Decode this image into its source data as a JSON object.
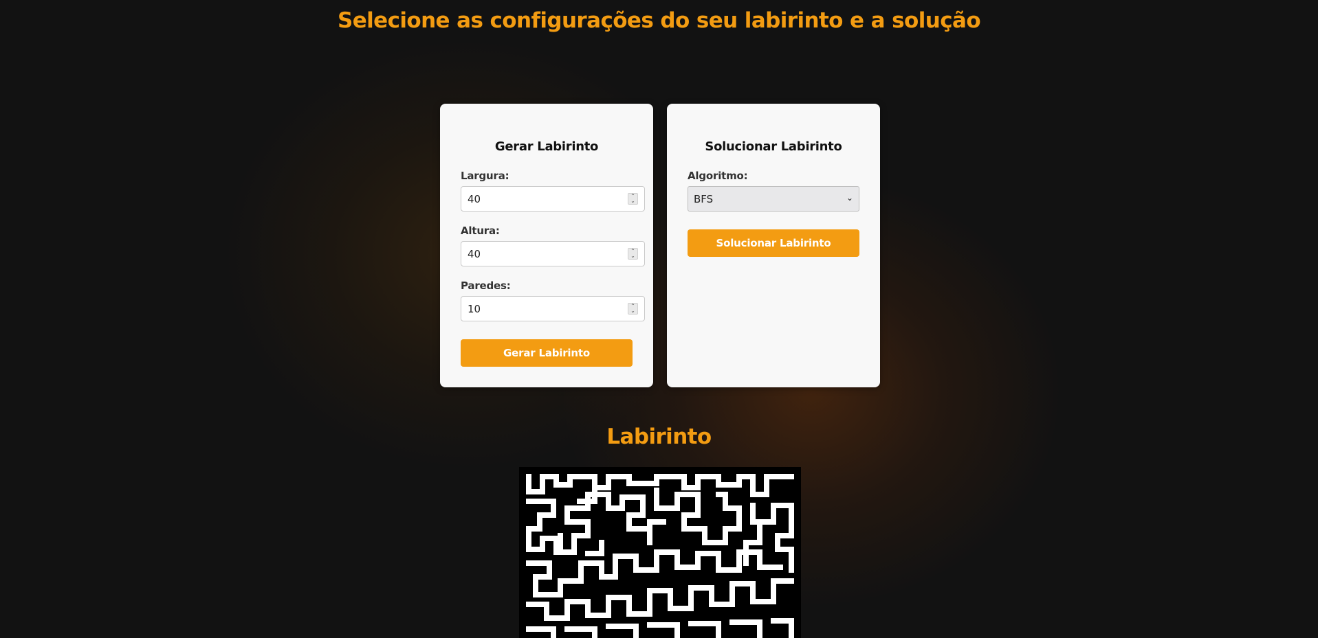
{
  "header": {
    "title": "Selecione as configurações do seu labirinto e a solução"
  },
  "generate_card": {
    "title": "Gerar Labirinto",
    "width_label": "Largura:",
    "width_value": "40",
    "height_label": "Altura:",
    "height_value": "40",
    "walls_label": "Paredes:",
    "walls_value": "10",
    "button_label": "Gerar Labirinto"
  },
  "solve_card": {
    "title": "Solucionar Labirinto",
    "algorithm_label": "Algoritmo:",
    "algorithm_selected": "BFS",
    "button_label": "Solucionar Labirinto"
  },
  "maze_section": {
    "title": "Labirinto"
  },
  "colors": {
    "accent": "#f39c12",
    "background": "#121212",
    "card": "#f8f8f8",
    "maze_wall": "#000000",
    "maze_path": "#ffffff"
  },
  "icons": {
    "spinner": "number-spinner-icon",
    "select_arrow": "chevron-down-icon"
  }
}
